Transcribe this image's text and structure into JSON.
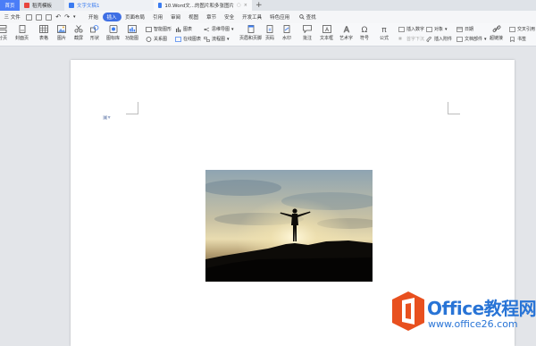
{
  "tabs": {
    "home": "首页",
    "t1": "稻壳模板",
    "t2": "文字文稿1",
    "t3": "10.Word文...的图片和多张图片",
    "plus": "+"
  },
  "menu": {
    "file": "三 文件",
    "items": [
      "开始",
      "插入",
      "页面布局",
      "引用",
      "审阅",
      "视图",
      "章节",
      "安全",
      "开发工具",
      "特色应用"
    ],
    "active_index": 1,
    "search": "查找"
  },
  "ribbon": {
    "page": "分页",
    "cover": "封面页",
    "table": "表格",
    "picture": "图片",
    "screenshot": "截屏",
    "shape": "形状",
    "icon_lib": "图标库",
    "func_chart": "功能图",
    "smart_shape": "智能图形",
    "chart": "图表",
    "mind_map": "思维导图",
    "relation": "关系图",
    "online_chart": "在线图表",
    "flowchart": "流程图",
    "header_footer": "页眉和页脚",
    "page_num": "页码",
    "watermark": "水印",
    "comment": "批注",
    "textbox": "文本框",
    "wordart": "艺术字",
    "symbol": "符号",
    "formula": "公式",
    "insert_number": "插入数字",
    "first_drop": "首字下沉",
    "object": "对象",
    "attachment": "插入附件",
    "date": "日期",
    "doc_parts": "文档部件",
    "hyperlink": "超链接",
    "bookmark": "书签",
    "cross_ref": "交叉引用"
  },
  "watermark": {
    "title": "Office教程网",
    "url": "www.office26.com",
    "brand_color": "#2874d6",
    "logo_color": "#e8501f"
  }
}
